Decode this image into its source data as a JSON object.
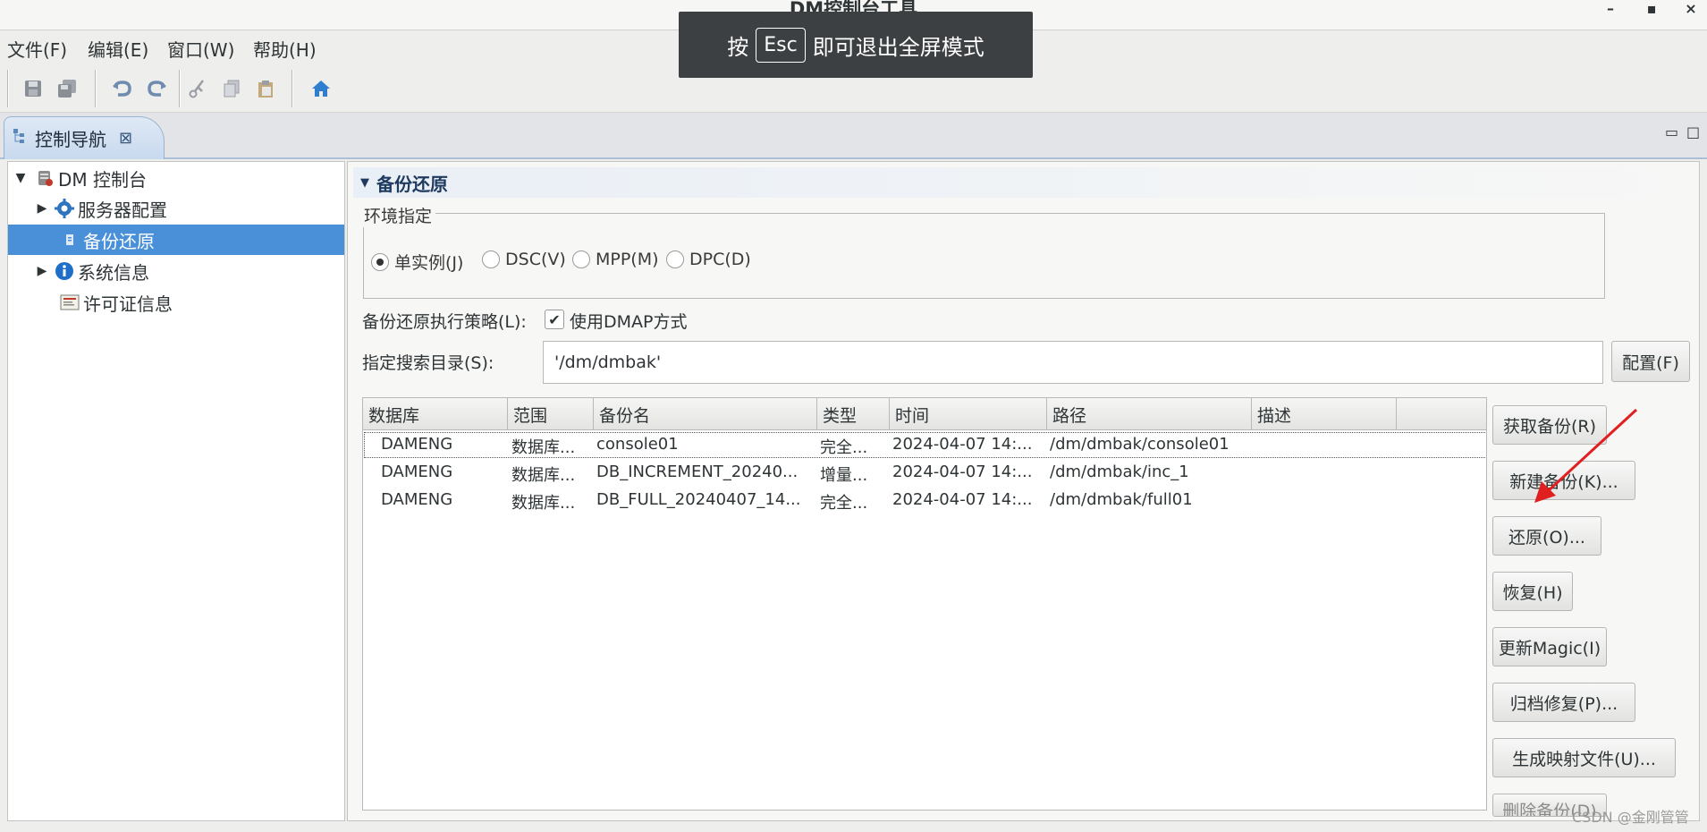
{
  "window": {
    "title": "DM控制台工具",
    "minimize": "–",
    "maximize": "▪",
    "close": "×"
  },
  "menubar": {
    "items": [
      "文件(F)",
      "编辑(E)",
      "窗口(W)",
      "帮助(H)"
    ]
  },
  "overlay": {
    "prefix": "按",
    "key": "Esc",
    "suffix": "即可退出全屏模式"
  },
  "toolbar": {
    "icons": [
      "save-icon",
      "save-all-icon",
      "undo-icon",
      "redo-icon",
      "cut-icon",
      "copy-icon",
      "paste-icon",
      "home-icon"
    ]
  },
  "tab": {
    "label": "控制导航",
    "close": "⊠"
  },
  "view_controls": {
    "minimize": "▭",
    "maximize": "□"
  },
  "tree": {
    "root": "DM 控制台",
    "items": [
      {
        "label": "服务器配置",
        "icon": "gear-icon",
        "expandable": true
      },
      {
        "label": "备份还原",
        "icon": "backup-icon",
        "expandable": false,
        "selected": true
      },
      {
        "label": "系统信息",
        "icon": "info-icon",
        "expandable": true
      },
      {
        "label": "许可证信息",
        "icon": "license-icon",
        "expandable": false
      }
    ]
  },
  "main": {
    "section_title": "备份还原",
    "env_legend": "环境指定",
    "env_options": [
      {
        "label": "单实例(J)",
        "checked": true
      },
      {
        "label": "DSC(V)",
        "checked": false
      },
      {
        "label": "MPP(M)",
        "checked": false
      },
      {
        "label": "DPC(D)",
        "checked": false
      }
    ],
    "policy_label": "备份还原执行策略(L):",
    "dmap_label": "使用DMAP方式",
    "dmap_checked": true,
    "dir_label": "指定搜索目录(S):",
    "dir_value": "'/dm/dmbak'",
    "config_button": "配置(F)",
    "table": {
      "columns": [
        "数据库",
        "范围",
        "备份名",
        "类型",
        "时间",
        "路径",
        "描述"
      ],
      "rows": [
        [
          "DAMENG",
          "数据库...",
          "console01",
          "完全...",
          "2024-04-07 14:...",
          "/dm/dmbak/console01",
          ""
        ],
        [
          "DAMENG",
          "数据库...",
          "DB_INCREMENT_20240...",
          "增量...",
          "2024-04-07 14:...",
          "/dm/dmbak/inc_1",
          ""
        ],
        [
          "DAMENG",
          "数据库...",
          "DB_FULL_20240407_14...",
          "完全...",
          "2024-04-07 14:...",
          "/dm/dmbak/full01",
          ""
        ]
      ]
    },
    "side_buttons": [
      "获取备份(R)",
      "新建备份(K)...",
      "还原(O)...",
      "恢复(H)",
      "更新Magic(I)",
      "归档修复(P)...",
      "生成映射文件(U)...",
      "删除备份(D)"
    ]
  },
  "watermark": "CSDN @金刚管管",
  "colors": {
    "selection": "#4a90d9",
    "arrow": "#e02020"
  }
}
